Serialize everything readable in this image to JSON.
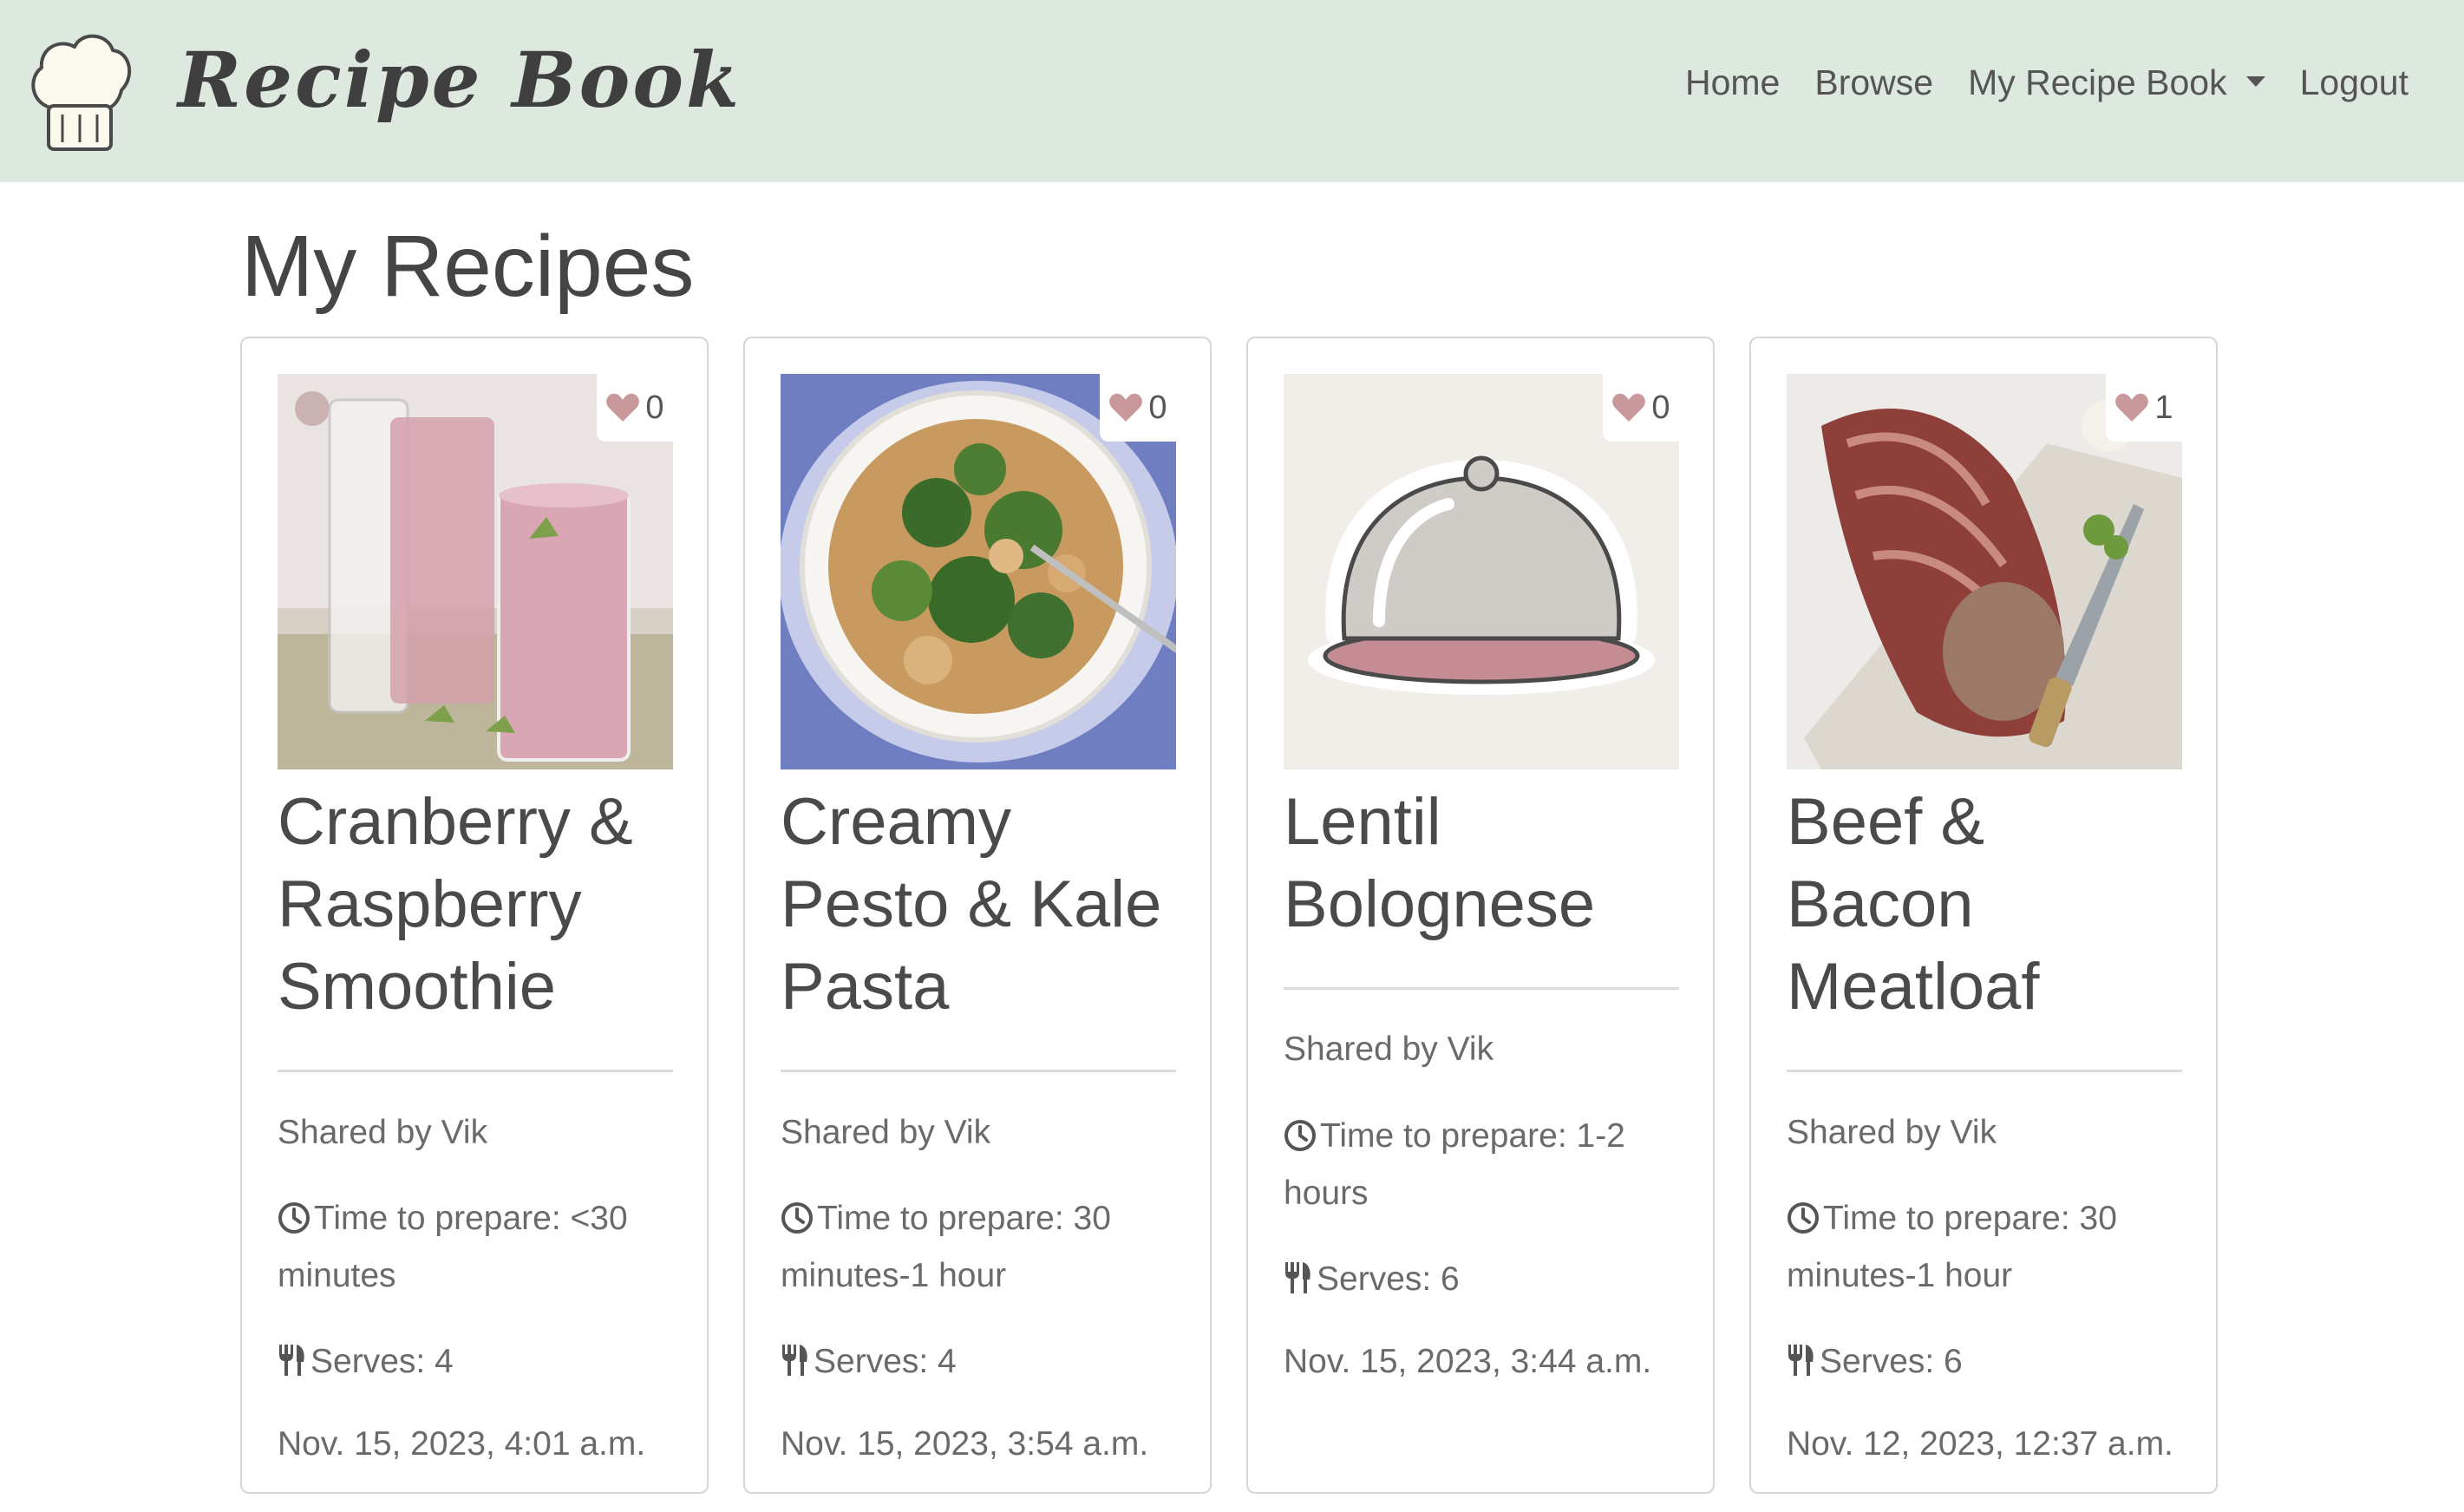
{
  "brand": "Recipe Book",
  "nav": {
    "home": "Home",
    "browse": "Browse",
    "my_recipe_book": "My Recipe Book",
    "logout": "Logout"
  },
  "page_title": "My Recipes",
  "recipes": [
    {
      "title": "Cranberry & Raspberry Smoothie",
      "likes": "0",
      "shared_by": "Shared by Vik",
      "time": "Time to prepare: <30 minutes",
      "serves": "Serves: 4",
      "date": "Nov. 15, 2023, 4:01 a.m."
    },
    {
      "title": "Creamy Pesto & Kale Pasta",
      "likes": "0",
      "shared_by": "Shared by Vik",
      "time": "Time to prepare: 30 minutes-1 hour",
      "serves": "Serves: 4",
      "date": "Nov. 15, 2023, 3:54 a.m."
    },
    {
      "title": "Lentil Bolognese",
      "likes": "0",
      "shared_by": "Shared by Vik",
      "time": "Time to prepare: 1-2 hours",
      "serves": "Serves: 6",
      "date": "Nov. 15, 2023, 3:44 a.m."
    },
    {
      "title": "Beef & Bacon Meatloaf",
      "likes": "1",
      "shared_by": "Shared by Vik",
      "time": "Time to prepare: 30 minutes-1 hour",
      "serves": "Serves: 6",
      "date": "Nov. 12, 2023, 12:37 a.m."
    }
  ],
  "icons": {
    "logo": "chef-hat-icon",
    "like": "heart-icon",
    "time": "clock-icon",
    "serves": "utensils-icon"
  },
  "colors": {
    "navbar_bg": "#dde9df",
    "heart": "#c8989b",
    "text": "#4a4a4a"
  }
}
